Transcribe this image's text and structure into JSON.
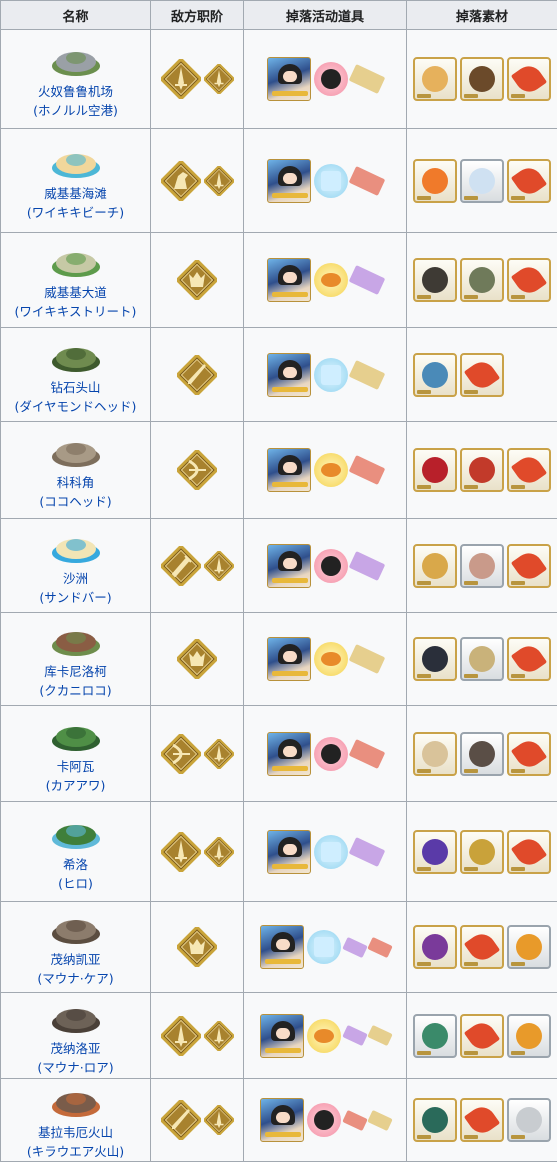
{
  "headers": [
    "名称",
    "敌方职阶",
    "掉落活动道具",
    "掉落素材"
  ],
  "rows": [
    {
      "name": "火奴鲁鲁机场",
      "jp": "(ホノルル空港)",
      "loc_icon": "airport-icon",
      "loc_colors": [
        "#9aa0a6",
        "#6b8f4e"
      ],
      "classes": [
        "saber",
        "saber"
      ],
      "items": [
        "card-mio",
        "ink",
        "ticket-gold"
      ],
      "mats": [
        "horn",
        "scroll",
        "feather"
      ]
    },
    {
      "name": "威基基海滩",
      "jp": "(ワイキキビーチ)",
      "loc_icon": "beach-icon",
      "loc_colors": [
        "#f1d79b",
        "#4cb7d6"
      ],
      "classes": [
        "rider",
        "saber"
      ],
      "items": [
        "card-mio",
        "manuscript",
        "ticket-red"
      ],
      "mats": [
        "flame",
        "crystal",
        "feather"
      ]
    },
    {
      "name": "威基基大道",
      "jp": "(ワイキキストリート)",
      "loc_icon": "street-icon",
      "loc_colors": [
        "#c6c9a5",
        "#5d9b4b"
      ],
      "classes": [
        "berserker"
      ],
      "items": [
        "card-mio",
        "bun",
        "ticket-purple"
      ],
      "mats": [
        "cauldron",
        "disk",
        "feather"
      ]
    },
    {
      "name": "钻石头山",
      "jp": "(ダイヤモンドヘッド)",
      "loc_icon": "crater-icon",
      "loc_colors": [
        "#6f8b4f",
        "#3e5a2d"
      ],
      "classes": [
        "lancer"
      ],
      "items": [
        "card-mio",
        "manuscript",
        "ticket-gold"
      ],
      "mats": [
        "jewel",
        "feather"
      ]
    },
    {
      "name": "科科角",
      "jp": "(ココヘッド)",
      "loc_icon": "hill-icon",
      "loc_colors": [
        "#a89a86",
        "#7d6e5c"
      ],
      "classes": [
        "archer"
      ],
      "items": [
        "card-mio",
        "bun",
        "ticket-red"
      ],
      "mats": [
        "blood",
        "fang",
        "feather"
      ]
    },
    {
      "name": "沙洲",
      "jp": "(サンドバー)",
      "loc_icon": "sandbar-icon",
      "loc_colors": [
        "#f2e5b5",
        "#36a9de"
      ],
      "classes": [
        "caster",
        "saber"
      ],
      "items": [
        "card-mio",
        "ink",
        "ticket-purple"
      ],
      "mats": [
        "lamp",
        "shell",
        "feather"
      ]
    },
    {
      "name": "库卡尼洛柯",
      "jp": "(クカニロコ)",
      "loc_icon": "plateau-icon",
      "loc_colors": [
        "#8a5d44",
        "#6e8d4c"
      ],
      "classes": [
        "berserker"
      ],
      "items": [
        "card-mio",
        "bun",
        "ticket-gold"
      ],
      "mats": [
        "claw",
        "gear",
        "feather"
      ]
    },
    {
      "name": "卡阿瓦",
      "jp": "(カアアワ)",
      "loc_icon": "mountain-icon",
      "loc_colors": [
        "#4f8f46",
        "#2f6030"
      ],
      "classes": [
        "archer",
        "saber"
      ],
      "items": [
        "card-mio",
        "ink",
        "ticket-red"
      ],
      "mats": [
        "vase",
        "stone",
        "feather"
      ]
    },
    {
      "name": "希洛",
      "jp": "(ヒロ)",
      "loc_icon": "waterfall-icon",
      "loc_colors": [
        "#3f7f3a",
        "#5fb9d8"
      ],
      "classes": [
        "saber",
        "saber"
      ],
      "items": [
        "card-mio",
        "manuscript",
        "ticket-purple"
      ],
      "mats": [
        "heart",
        "bell",
        "feather"
      ]
    },
    {
      "name": "茂纳凯亚",
      "jp": "(マウナ·ケア)",
      "loc_icon": "volcano-icon",
      "loc_colors": [
        "#8c7c6c",
        "#5b4d40"
      ],
      "classes": [
        "berserker"
      ],
      "items": [
        "card-mio",
        "manuscript",
        "ticket-purple",
        "ticket-red"
      ],
      "mats": [
        "orb",
        "feather",
        "flower"
      ]
    },
    {
      "name": "茂纳洛亚",
      "jp": "(マウナ·ロア)",
      "loc_icon": "caldera-icon",
      "loc_colors": [
        "#6d6257",
        "#4a4038"
      ],
      "classes": [
        "saber",
        "saber"
      ],
      "items": [
        "card-mio",
        "bun",
        "ticket-purple",
        "ticket-gold"
      ],
      "mats": [
        "seed",
        "feather",
        "flower"
      ]
    },
    {
      "name": "基拉韦厄火山",
      "jp": "(キラウエア火山)",
      "loc_icon": "lava-icon",
      "loc_colors": [
        "#7a5c4a",
        "#c46a3a"
      ],
      "classes": [
        "lancer",
        "saber"
      ],
      "items": [
        "card-mio",
        "ink",
        "ticket-red",
        "ticket-gold"
      ],
      "mats": [
        "wing",
        "feather",
        "leaf"
      ]
    }
  ],
  "colors": {
    "header_bg": "#eaecf0",
    "cell_bg": "#f8f9fa",
    "border": "#a2a9b1",
    "link": "#0645ad",
    "class_gold": "#c9a43a"
  }
}
